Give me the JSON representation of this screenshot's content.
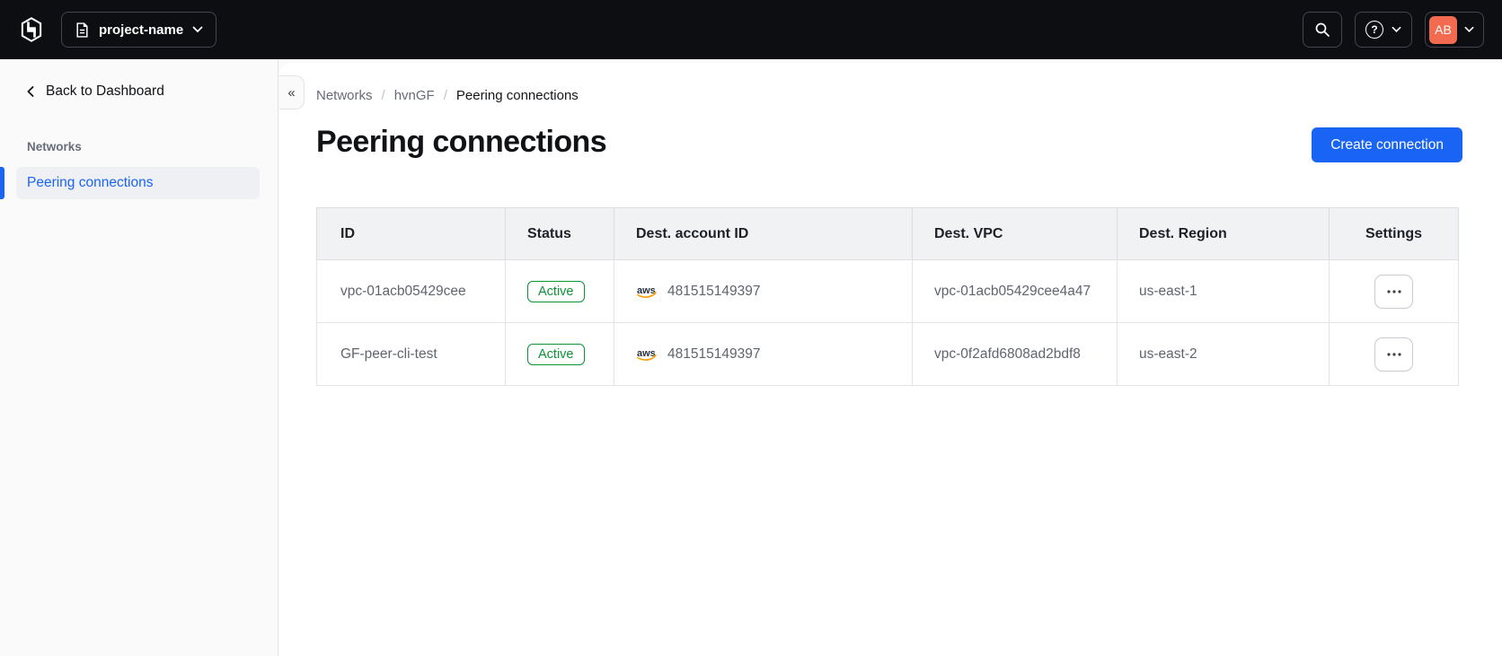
{
  "topnav": {
    "project_switcher_label": "project-name",
    "avatar_initials": "AB",
    "help_glyph": "?"
  },
  "sidebar": {
    "back_label": "Back to Dashboard",
    "section_label": "Networks",
    "items": [
      {
        "label": "Peering connections",
        "active": true
      }
    ],
    "collapse_glyph": "«"
  },
  "breadcrumb": {
    "separator": "/",
    "items": [
      "Networks",
      "hvnGF",
      "Peering connections"
    ]
  },
  "page": {
    "title": "Peering connections",
    "create_button_label": "Create connection"
  },
  "table": {
    "columns": [
      "ID",
      "Status",
      "Dest. account ID",
      "Dest. VPC",
      "Dest. Region",
      "Settings"
    ],
    "rows": [
      {
        "id": "vpc-01acb05429cee",
        "status": "Active",
        "provider": "aws",
        "account_id": "481515149397",
        "vpc": "vpc-01acb05429cee4a47",
        "region": "us-east-1"
      },
      {
        "id": "GF-peer-cli-test",
        "status": "Active",
        "provider": "aws",
        "account_id": "481515149397",
        "vpc": "vpc-0f2afd6808ad2bdf8",
        "region": "us-east-2"
      }
    ]
  },
  "colors": {
    "topnav_bg": "#0d0e12",
    "accent_blue": "#1a64f5",
    "success_green": "#0a9434",
    "avatar_bg": "#f26b50",
    "aws_orange": "#ff9900"
  }
}
